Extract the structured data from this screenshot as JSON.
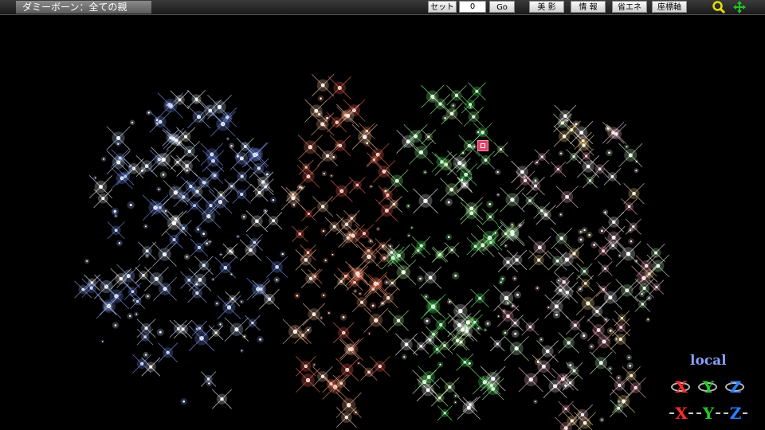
{
  "title": "ダミーボーン：全ての親",
  "toolbar": {
    "set_label": "セット",
    "frame_value": "0",
    "go_label": "Go",
    "beauty_label": "美 影",
    "info_label": "情 報",
    "eco_label": "省エネ",
    "axis_label": "座標軸"
  },
  "icons": {
    "zoom": "magnifier-icon",
    "move": "move-cross-icon"
  },
  "gizmo": {
    "mode_label": "local",
    "rotate": [
      "X",
      "Y",
      "Z"
    ],
    "move": [
      "X",
      "Y",
      "Z"
    ]
  },
  "colors": {
    "x_axis": "#ff2a2a",
    "y_axis": "#22cc22",
    "z_axis": "#2a7fff",
    "local_label": "#8aa0ff",
    "selected_bone": "#e0436a"
  }
}
